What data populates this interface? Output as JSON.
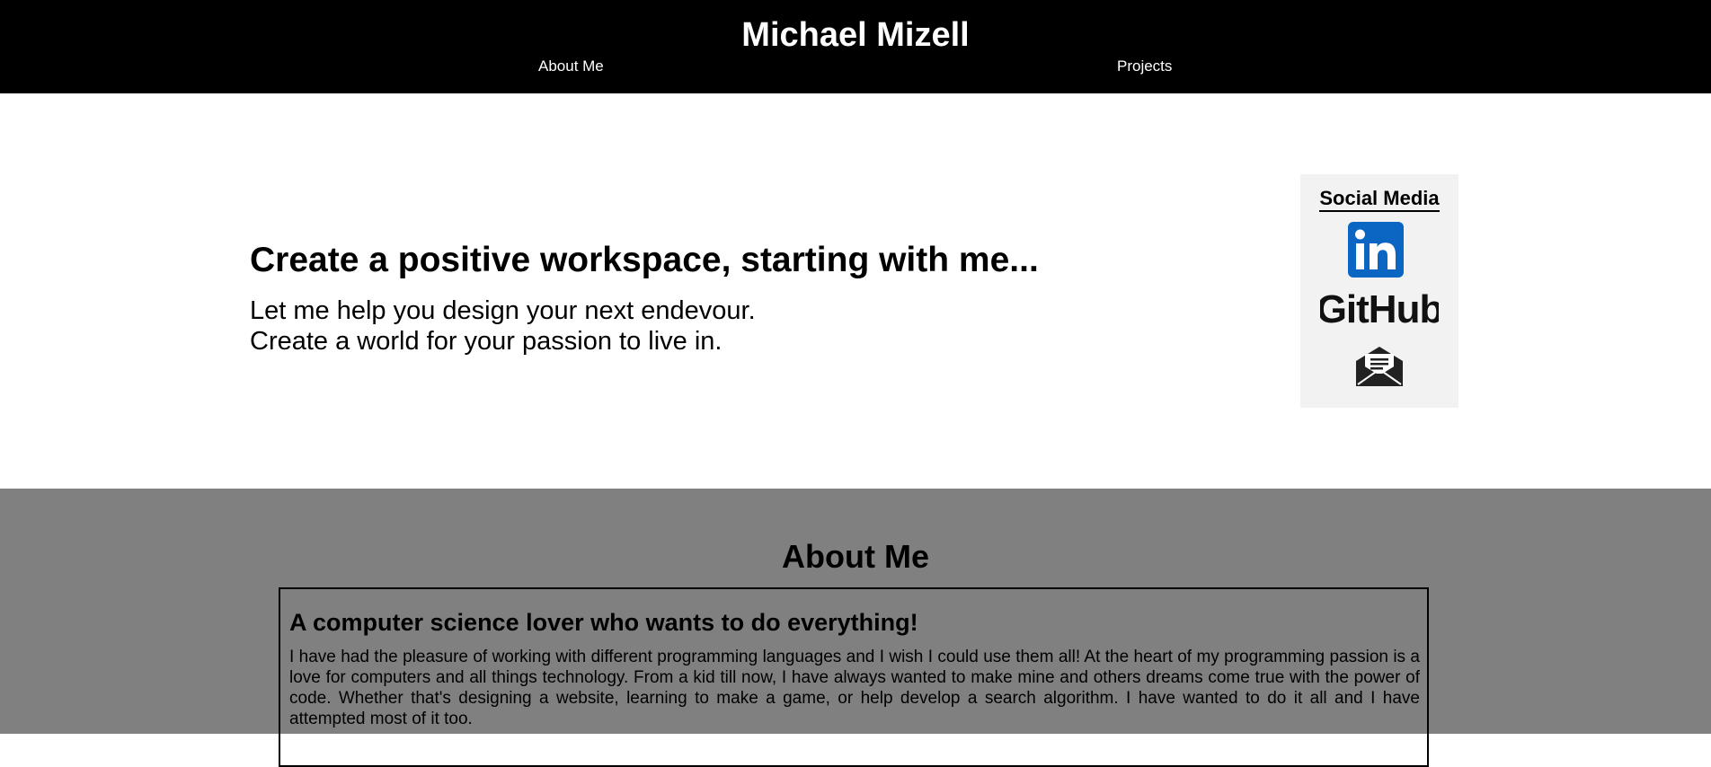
{
  "header": {
    "title": "Michael Mizell",
    "nav": {
      "about": "About Me",
      "projects": "Projects"
    }
  },
  "hero": {
    "heading": "Create a positive workspace, starting with me...",
    "line1": "Let me help you design your next endevour.",
    "line2": "Create a world for your passion to live in."
  },
  "social": {
    "title": "Social Media",
    "icons": [
      {
        "name": "linkedin-icon",
        "text": "in",
        "color": "#0a66c2"
      },
      {
        "name": "github-icon",
        "text": "GitHub",
        "color": "#111111"
      },
      {
        "name": "email-icon",
        "color": "#222222"
      }
    ]
  },
  "about": {
    "title": "About Me",
    "card_heading": "A computer science lover who wants to do everything!",
    "card_body": "I have had the pleasure of working with different programming languages and I wish I could use them all! At the heart of my programming passion is a love for computers and all things technology. From a kid till now, I have always wanted to make mine and others dreams come true with the power of code. Whether that's designing a website, learning to make a game, or help develop a search algorithm. I have wanted to do it all and I have attempted most of it too."
  },
  "colors": {
    "header_bg": "#000000",
    "about_bg": "#808080",
    "social_bg": "#f2f2f2"
  }
}
